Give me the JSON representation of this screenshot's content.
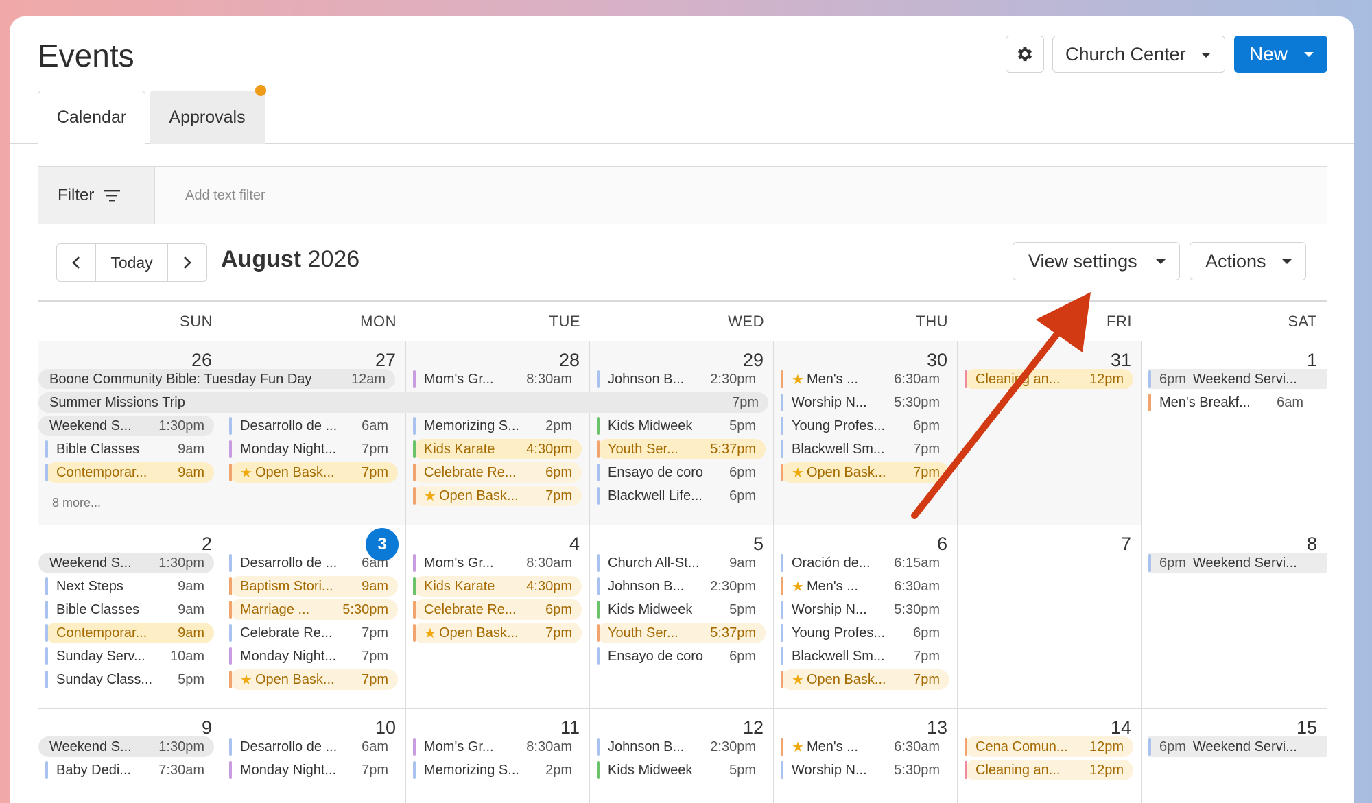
{
  "app": {
    "title": "Events",
    "church_center_label": "Church Center",
    "new_label": "New",
    "tabs": [
      "Calendar",
      "Approvals"
    ]
  },
  "filter": {
    "label": "Filter",
    "placeholder": "Add text filter"
  },
  "toolbar": {
    "today_label": "Today",
    "month": "August",
    "year": "2026",
    "view_settings_label": "View settings",
    "actions_label": "Actions"
  },
  "days_of_week": [
    "SUN",
    "MON",
    "TUE",
    "WED",
    "THU",
    "FRI",
    "SAT"
  ],
  "weeks": [
    {
      "days": [
        "26",
        "27",
        "28",
        "29",
        "30",
        "31",
        "1"
      ],
      "spans": [
        {
          "name": "Boone Community Bible: Tuesday Fun Day",
          "time": "12am"
        },
        {
          "name": "Summer Missions Trip",
          "time": "7pm"
        }
      ],
      "sun": [
        {
          "name": "Weekend S...",
          "time": "1:30pm"
        },
        {
          "name": "Bible Classes",
          "time": "9am"
        },
        {
          "name": "Contemporar...",
          "time": "9am"
        }
      ],
      "sun_more": "8 more...",
      "mon": [
        {
          "name": "Desarrollo de ...",
          "time": "6am"
        },
        {
          "name": "Monday Night...",
          "time": "7pm"
        },
        {
          "name": "Open Bask...",
          "time": "7pm"
        }
      ],
      "tue": [
        {
          "name": "Mom's Gr...",
          "time": "8:30am"
        },
        {
          "name": "Memorizing S...",
          "time": "2pm"
        },
        {
          "name": "Kids Karate",
          "time": "4:30pm"
        },
        {
          "name": "Celebrate Re...",
          "time": "6pm"
        },
        {
          "name": "Open Bask...",
          "time": "7pm"
        }
      ],
      "wed": [
        {
          "name": "Johnson B...",
          "time": "2:30pm"
        },
        {
          "name": "Kids Midweek",
          "time": "5pm"
        },
        {
          "name": "Youth Ser...",
          "time": "5:37pm"
        },
        {
          "name": "Ensayo de coro",
          "time": "6pm"
        },
        {
          "name": "Blackwell Life...",
          "time": "6pm"
        }
      ],
      "thu": [
        {
          "name": "Men's ...",
          "time": "6:30am"
        },
        {
          "name": "Worship N...",
          "time": "5:30pm"
        },
        {
          "name": "Young Profes...",
          "time": "6pm"
        },
        {
          "name": "Blackwell Sm...",
          "time": "7pm"
        },
        {
          "name": "Open Bask...",
          "time": "7pm"
        }
      ],
      "fri": [
        {
          "name": "Cleaning an...",
          "time": "12pm"
        }
      ],
      "sat": [
        {
          "name": "Weekend Servi...",
          "time": "6pm"
        },
        {
          "name": "Men's Breakf...",
          "time": "6am"
        }
      ]
    },
    {
      "days": [
        "2",
        "3",
        "4",
        "5",
        "6",
        "7",
        "8"
      ],
      "sun": [
        {
          "name": "Weekend S...",
          "time": "1:30pm"
        },
        {
          "name": "Next Steps",
          "time": "9am"
        },
        {
          "name": "Bible Classes",
          "time": "9am"
        },
        {
          "name": "Contemporar...",
          "time": "9am"
        },
        {
          "name": "Sunday Serv...",
          "time": "10am"
        },
        {
          "name": "Sunday Class...",
          "time": "5pm"
        }
      ],
      "mon": [
        {
          "name": "Desarrollo de ...",
          "time": "6am"
        },
        {
          "name": "Baptism Stori...",
          "time": "9am"
        },
        {
          "name": "Marriage ...",
          "time": "5:30pm"
        },
        {
          "name": "Celebrate Re...",
          "time": "7pm"
        },
        {
          "name": "Monday Night...",
          "time": "7pm"
        },
        {
          "name": "Open Bask...",
          "time": "7pm"
        }
      ],
      "tue": [
        {
          "name": "Mom's Gr...",
          "time": "8:30am"
        },
        {
          "name": "Kids Karate",
          "time": "4:30pm"
        },
        {
          "name": "Celebrate Re...",
          "time": "6pm"
        },
        {
          "name": "Open Bask...",
          "time": "7pm"
        }
      ],
      "wed": [
        {
          "name": "Church All-St...",
          "time": "9am"
        },
        {
          "name": "Johnson B...",
          "time": "2:30pm"
        },
        {
          "name": "Kids Midweek",
          "time": "5pm"
        },
        {
          "name": "Youth Ser...",
          "time": "5:37pm"
        },
        {
          "name": "Ensayo de coro",
          "time": "6pm"
        }
      ],
      "thu": [
        {
          "name": "Oración de...",
          "time": "6:15am"
        },
        {
          "name": "Men's ...",
          "time": "6:30am"
        },
        {
          "name": "Worship N...",
          "time": "5:30pm"
        },
        {
          "name": "Young Profes...",
          "time": "6pm"
        },
        {
          "name": "Blackwell Sm...",
          "time": "7pm"
        },
        {
          "name": "Open Bask...",
          "time": "7pm"
        }
      ],
      "sat": [
        {
          "name": "Weekend Servi...",
          "time": "6pm"
        }
      ]
    },
    {
      "days": [
        "9",
        "10",
        "11",
        "12",
        "13",
        "14",
        "15"
      ],
      "sun": [
        {
          "name": "Weekend S...",
          "time": "1:30pm"
        },
        {
          "name": "Baby Dedi...",
          "time": "7:30am"
        }
      ],
      "mon": [
        {
          "name": "Desarrollo de ...",
          "time": "6am"
        },
        {
          "name": "Monday Night...",
          "time": "7pm"
        }
      ],
      "tue": [
        {
          "name": "Mom's Gr...",
          "time": "8:30am"
        },
        {
          "name": "Memorizing S...",
          "time": "2pm"
        }
      ],
      "wed": [
        {
          "name": "Johnson B...",
          "time": "2:30pm"
        },
        {
          "name": "Kids Midweek",
          "time": "5pm"
        }
      ],
      "thu": [
        {
          "name": "Men's ...",
          "time": "6:30am"
        },
        {
          "name": "Worship N...",
          "time": "5:30pm"
        }
      ],
      "fri": [
        {
          "name": "Cena Comun...",
          "time": "12pm"
        },
        {
          "name": "Cleaning an...",
          "time": "12pm"
        }
      ],
      "sat": [
        {
          "name": "Weekend Servi...",
          "time": "6pm"
        }
      ]
    }
  ],
  "colors": {
    "accent": "#0a7ad6",
    "notification_dot": "#ee9b17",
    "annotation_arrow": "#d13a12",
    "highlight_event": "#fdeec5"
  }
}
